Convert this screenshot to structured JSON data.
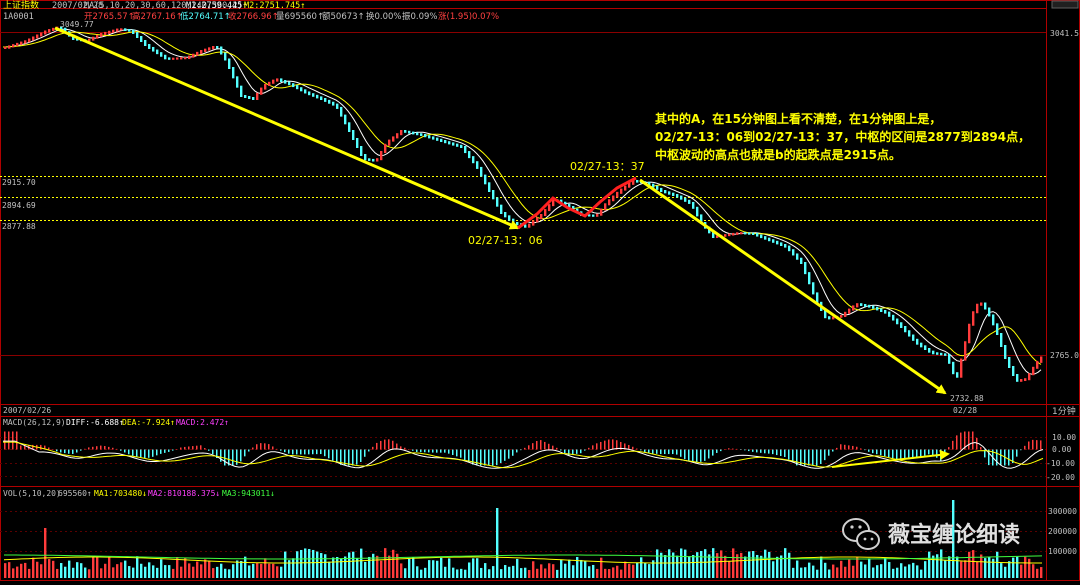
{
  "header": {
    "title": "上证指数",
    "date": "2007/02/28",
    "ma_params": "MA(5,10,20,30,60,120,240,360,2)",
    "m1": "M1:2759.445↑",
    "m2": "M2:2751.745↑",
    "code": "1A0001",
    "open": "开2765.57↑",
    "high": "高2767.16↑",
    "low": "低2764.71↑",
    "close": "收2766.96↑",
    "volume": "量695560↑",
    "amount": "额50673↑",
    "turnover": "换0.00%",
    "amplitude": "振0.09%",
    "change": "涨(1.95)0.07%"
  },
  "annotation": {
    "line1": "其中的A，在15分钟图上看不清楚，在1分钟图上是，",
    "line2": "02/27-13：06到02/27-13：37，中枢的区间是2877到2894点，",
    "line3": "中枢波动的高点也就是b的起跌点是2915点。"
  },
  "labels": {
    "t1": "02/27-13：37",
    "t2": "02/27-13：06",
    "start_price": "3049.77",
    "end_price": "2732.88"
  },
  "price_levels": [
    "2915.70",
    "2894.69",
    "2877.88"
  ],
  "price_axis": [
    "3041.5",
    "2765.0"
  ],
  "bottom_date_left": "2007/02/26",
  "bottom_date_right": "02/28",
  "period": "1分钟",
  "macd": {
    "label": "MACD(26,12,9)",
    "dif": "DIFF:-6.688↑",
    "dea": "DEA:-7.924↑",
    "macd": "MACD:2.472↑",
    "axis": [
      "10.00",
      "0.00",
      "-10.00",
      "-20.00"
    ]
  },
  "vol": {
    "label": "VOL(5,10,20)",
    "value": "695560↑",
    "ma1": "MA1:703480↓",
    "ma2": "MA2:810188.375↓",
    "ma3": "MA3:943011↓",
    "axis": [
      "300000",
      "200000",
      "100000"
    ]
  },
  "watermark": "薇宝缠论细读",
  "colors": {
    "up": "#ff3c3c",
    "down": "#54ffff",
    "ma_white": "#ffffff",
    "ma_yellow": "#ffff00",
    "trend_arrow": "#ffff00",
    "frame": "#b00000",
    "annotation_text": "#ffff00"
  },
  "chart_data": {
    "type": "line",
    "title": "上证指数",
    "xlabel": "",
    "ylabel": "",
    "ylim": [
      2732.88,
      3049.77
    ],
    "x": [
      "02/26 A",
      "02/27-13:06",
      "02/27-13:37",
      "02/28"
    ],
    "series": [
      {
        "name": "",
        "values": [
          3049.77,
          2877.88,
          2915.7,
          2732.88
        ]
      }
    ],
    "reference_lines": [
      2915.7,
      2894.69,
      2877.88
    ]
  }
}
